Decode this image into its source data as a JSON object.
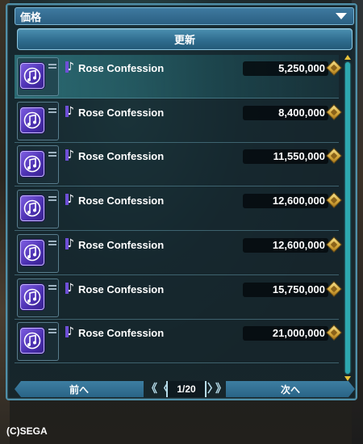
{
  "header": {
    "sort_label": "価格",
    "refresh_label": "更新"
  },
  "items": [
    {
      "name": "Rose Confession",
      "price": "5,250,000",
      "selected": true
    },
    {
      "name": "Rose Confession",
      "price": "8,400,000",
      "selected": false
    },
    {
      "name": "Rose Confession",
      "price": "11,550,000",
      "selected": false
    },
    {
      "name": "Rose Confession",
      "price": "12,600,000",
      "selected": false
    },
    {
      "name": "Rose Confession",
      "price": "12,600,000",
      "selected": false
    },
    {
      "name": "Rose Confession",
      "price": "15,750,000",
      "selected": false
    },
    {
      "name": "Rose Confession",
      "price": "21,000,000",
      "selected": false
    }
  ],
  "icons": {
    "item_icon": "music-disc-icon",
    "category_icon": "music-note-icon",
    "currency_icon": "meseta-icon"
  },
  "pager": {
    "prev_label": "前へ",
    "next_label": "次へ",
    "page_indicator": "1/20",
    "first_glyph": "《",
    "prev_glyph": "〈",
    "next_glyph": "〉",
    "last_glyph": "》"
  },
  "footer": {
    "copyright": "(C)SEGA"
  },
  "colors": {
    "panel_border": "#4f8fa8",
    "button_blue": "#2f6d8f",
    "scrollbar": "#2da8b0",
    "scroll_arrow": "#e8c23a",
    "icon_purple": "#5a3cc8",
    "meseta_gold": "#d5a83a"
  }
}
